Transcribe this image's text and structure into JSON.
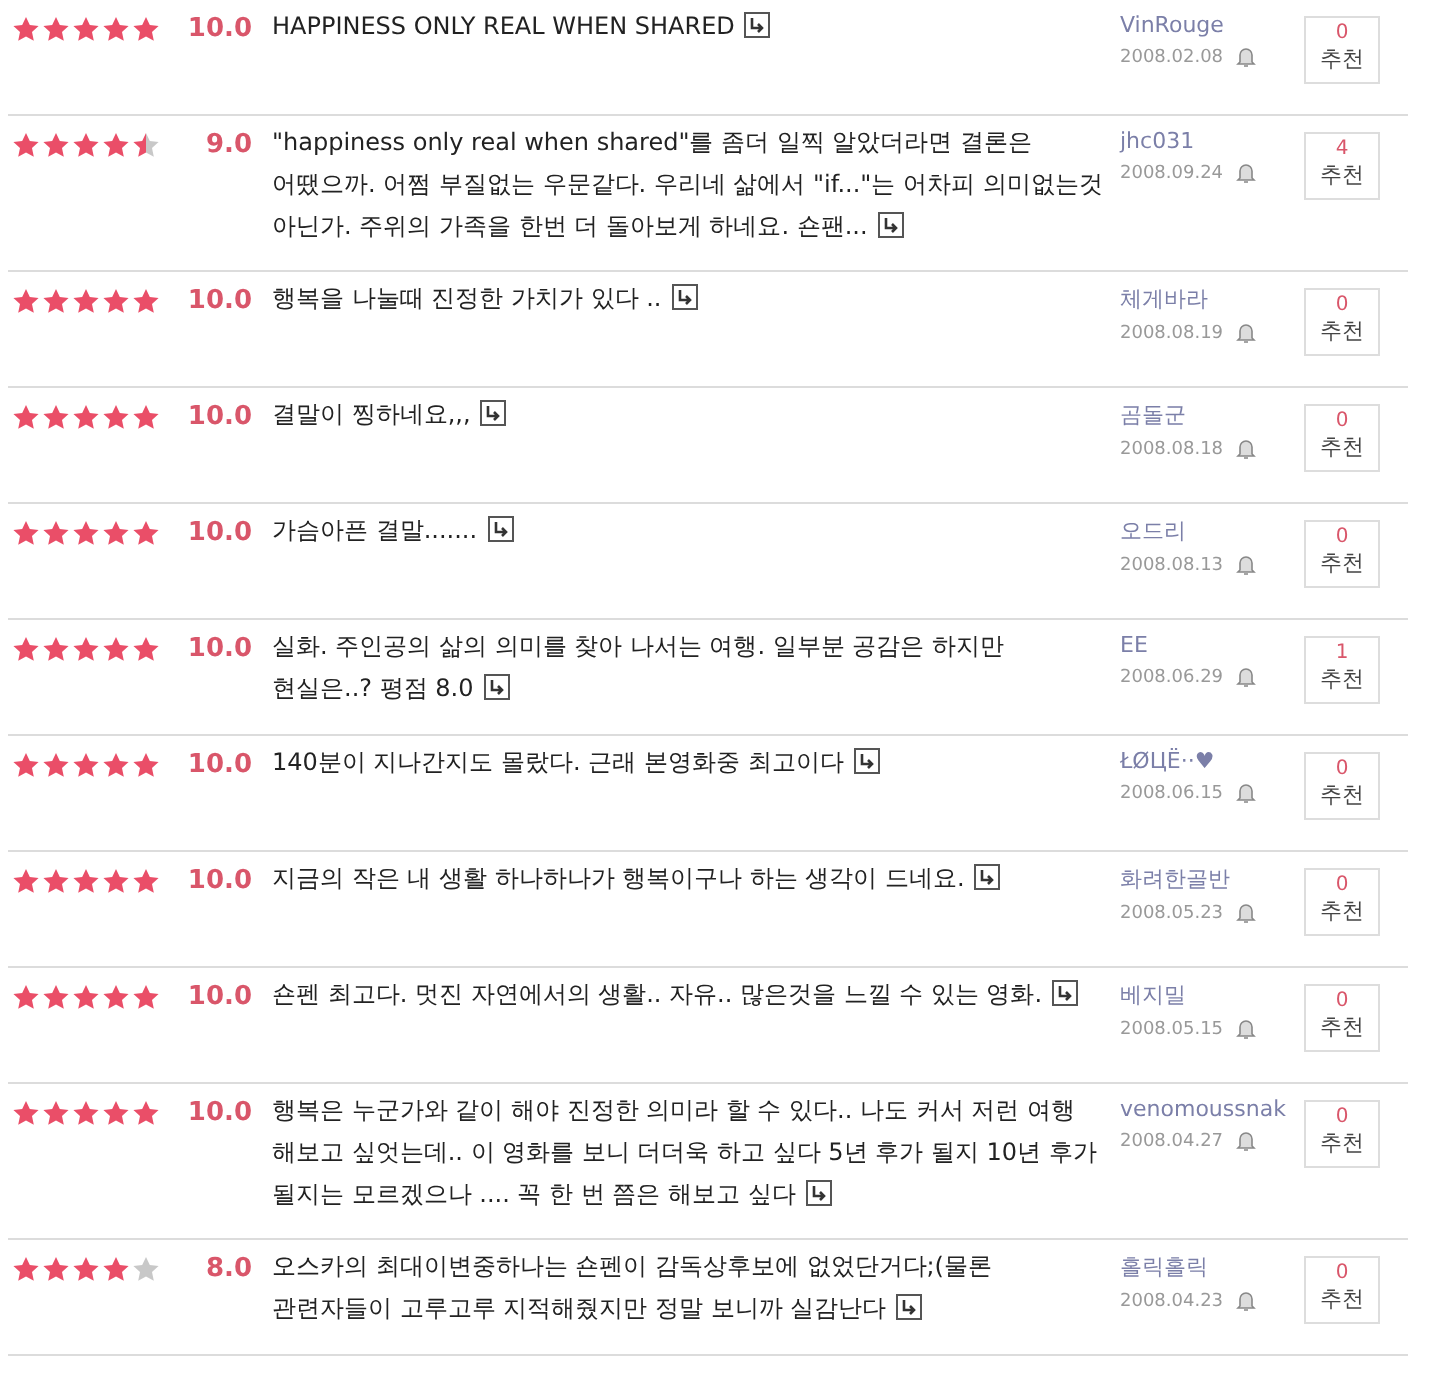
{
  "reviews": [
    {
      "stars": 5,
      "score": "10.0",
      "comment": "HAPPINESS ONLY REAL WHEN SHARED",
      "author": "VinRouge",
      "date": "2008.02.08",
      "count": "0",
      "recommend": "추천"
    },
    {
      "stars": 4.5,
      "score": "9.0",
      "comment": "\"happiness only real when shared\"를 좀더 일찍 알았더라면 결론은 어땠으까. 어쩜 부질없는 우문같다. 우리네 삶에서 \"if...\"는 어차피 의미없는것 아닌가. 주위의 가족을 한번 더 돌아보게 하네요. 숀팬...",
      "author": "jhc031",
      "date": "2008.09.24",
      "count": "4",
      "recommend": "추천"
    },
    {
      "stars": 5,
      "score": "10.0",
      "comment": "행복을 나눌때 진정한 가치가 있다 ..",
      "author": "체게바라",
      "date": "2008.08.19",
      "count": "0",
      "recommend": "추천"
    },
    {
      "stars": 5,
      "score": "10.0",
      "comment": "결말이 찡하네요,,,",
      "author": "곰돌군",
      "date": "2008.08.18",
      "count": "0",
      "recommend": "추천"
    },
    {
      "stars": 5,
      "score": "10.0",
      "comment": "가슴아픈 결말.......",
      "author": "오드리",
      "date": "2008.08.13",
      "count": "0",
      "recommend": "추천"
    },
    {
      "stars": 5,
      "score": "10.0",
      "comment": "실화. 주인공의 삶의 의미를 찾아 나서는 여행. 일부분 공감은 하지만 현실은..? 평점 8.0",
      "author": "EE",
      "date": "2008.06.29",
      "count": "1",
      "recommend": "추천"
    },
    {
      "stars": 5,
      "score": "10.0",
      "comment": "140분이 지나간지도 몰랐다. 근래 본영화중 최고이다",
      "author": "ŁØЦЁ··♥",
      "date": "2008.06.15",
      "count": "0",
      "recommend": "추천"
    },
    {
      "stars": 5,
      "score": "10.0",
      "comment": "지금의 작은 내 생활 하나하나가 행복이구나 하는 생각이 드네요.",
      "author": "화려한골반",
      "date": "2008.05.23",
      "count": "0",
      "recommend": "추천"
    },
    {
      "stars": 5,
      "score": "10.0",
      "comment": "숀펜 최고다. 멋진 자연에서의 생활.. 자유.. 많은것을 느낄 수 있는 영화.",
      "author": "베지밀",
      "date": "2008.05.15",
      "count": "0",
      "recommend": "추천"
    },
    {
      "stars": 5,
      "score": "10.0",
      "comment": "행복은 누군가와 같이 해야 진정한 의미라 할 수 있다.. 나도 커서 저런 여행 해보고 싶엇는데.. 이 영화를 보니 더더욱 하고 싶다 5년 후가 될지 10년 후가 될지는 모르겠으나 .... 꼭 한 번 쯤은 해보고 싶다",
      "author": "venomoussnak",
      "date": "2008.04.27",
      "count": "0",
      "recommend": "추천"
    },
    {
      "stars": 4,
      "score": "8.0",
      "comment": "오스카의 최대이변중하나는 숀펜이 감독상후보에 없었단거다;(물론 관련자들이 고루고루 지적해줬지만 정말 보니까 실감난다",
      "author": "홀릭홀릭",
      "date": "2008.04.23",
      "count": "0",
      "recommend": "추천"
    }
  ]
}
